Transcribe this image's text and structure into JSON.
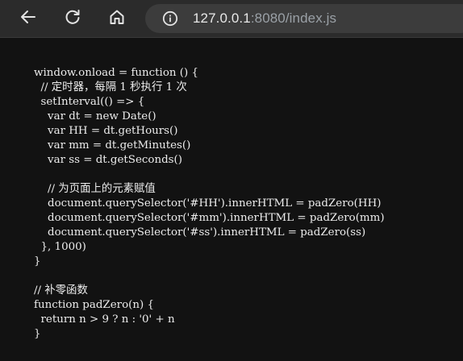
{
  "browser": {
    "url_host": "127.0.0.1",
    "url_rest": ":8080/index.js",
    "icons": {
      "back": "arrow-left-icon",
      "reload": "reload-icon",
      "home": "home-icon",
      "info": "info-icon"
    }
  },
  "page": {
    "code": "window.onload = function () {\n  // 定时器，每隔 1 秒执行 1 次\n  setInterval(() => {\n    var dt = new Date()\n    var HH = dt.getHours()\n    var mm = dt.getMinutes()\n    var ss = dt.getSeconds()\n\n    // 为页面上的元素赋值\n    document.querySelector('#HH').innerHTML = padZero(HH)\n    document.querySelector('#mm').innerHTML = padZero(mm)\n    document.querySelector('#ss').innerHTML = padZero(ss)\n  }, 1000)\n}\n\n// 补零函数\nfunction padZero(n) {\n  return n > 9 ? n : '0' + n\n}"
  },
  "colors": {
    "toolbar_bg": "#2b2b2b",
    "omnibox_bg": "#3c3c3c",
    "page_bg": "#121212",
    "text": "#ececec",
    "url_muted": "#9aa0a6"
  }
}
